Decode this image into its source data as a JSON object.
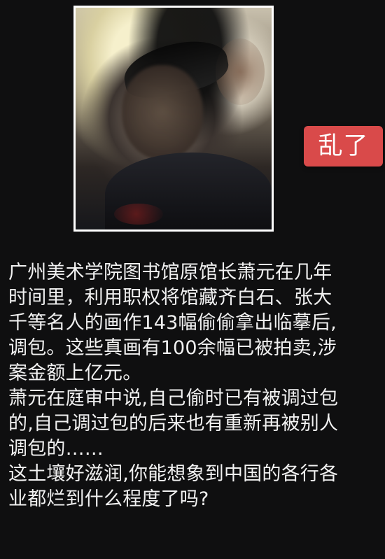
{
  "badge": {
    "label": "乱了"
  },
  "photo": {
    "description": "blurred photo"
  },
  "story": {
    "lines": [
      "广州美术学院图书馆原馆长萧元在几年",
      "时间里，利用职权将馆藏齐白石、张大",
      "千等名人的画作143幅偷偷拿出临摹后,",
      "调包。这些真画有100余幅已被拍卖,涉",
      "案金额上亿元。",
      "萧元在庭审中说,自己偷时已有被调过包",
      "的,自己调过包的后来也有重新再被别人",
      "调包的……",
      "这土壤好滋润,你能想象到中国的各行各",
      "业都烂到什么程度了吗?"
    ]
  }
}
